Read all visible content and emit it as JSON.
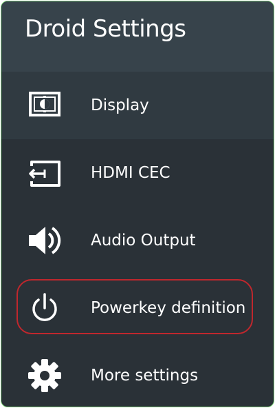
{
  "header": {
    "title": "Droid Settings"
  },
  "menu": {
    "items": [
      {
        "label": "Display",
        "icon": "display-icon",
        "selected": true
      },
      {
        "label": "HDMI CEC",
        "icon": "hdmi-input-icon",
        "selected": false
      },
      {
        "label": "Audio Output",
        "icon": "speaker-icon",
        "selected": false
      },
      {
        "label": "Powerkey definition",
        "icon": "power-icon",
        "selected": false,
        "highlighted": true
      },
      {
        "label": "More settings",
        "icon": "gear-icon",
        "selected": false
      }
    ]
  },
  "colors": {
    "panel_bg": "#2a3137",
    "header_bg": "#37434b",
    "selected_bg": "#303a41",
    "panel_border": "#7fd27a",
    "highlight_border": "#c0272d",
    "text": "#ffffff"
  }
}
